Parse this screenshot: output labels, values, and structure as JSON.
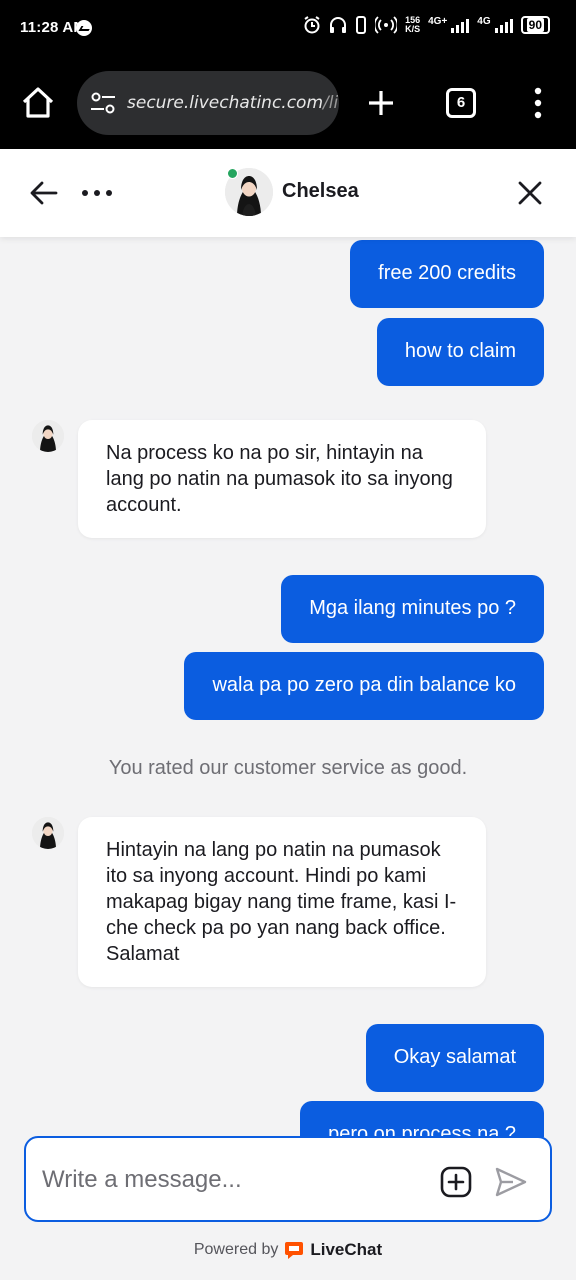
{
  "status_bar": {
    "time": "11:28 AM",
    "speed_value": "156",
    "speed_unit": "K/S",
    "net1": "4G+",
    "net2": "4G",
    "battery": "90"
  },
  "browser": {
    "url_main": "secure.livechatinc.com",
    "url_rest": "/lice",
    "tab_count": "6"
  },
  "chat": {
    "agent_name": "Chelsea",
    "messages": [
      {
        "type": "out",
        "text": "free 200 credits"
      },
      {
        "type": "out",
        "text": "how to claim"
      },
      {
        "type": "in",
        "text": "Na process ko na po sir, hintayin na lang po natin na pumasok ito sa inyong account."
      },
      {
        "type": "out",
        "text": "Mga ilang minutes po ?"
      },
      {
        "type": "out",
        "text": "wala pa po zero pa din balance ko"
      },
      {
        "type": "system",
        "text": "You rated our customer service as good."
      },
      {
        "type": "in",
        "text": "Hintayin na lang po natin na pumasok ito sa inyong account. Hindi po kami makapag bigay nang time frame, kasi I-che check pa po yan nang back office. Salamat"
      },
      {
        "type": "out",
        "text": "Okay salamat"
      },
      {
        "type": "out",
        "text": "pero on process na ?"
      }
    ]
  },
  "composer": {
    "placeholder": "Write a message..."
  },
  "footer": {
    "powered_by": "Powered by",
    "brand": "LiveChat"
  },
  "colors": {
    "accent": "#0b5de0",
    "online": "#25a55f",
    "livechat_orange": "#ff5100"
  }
}
